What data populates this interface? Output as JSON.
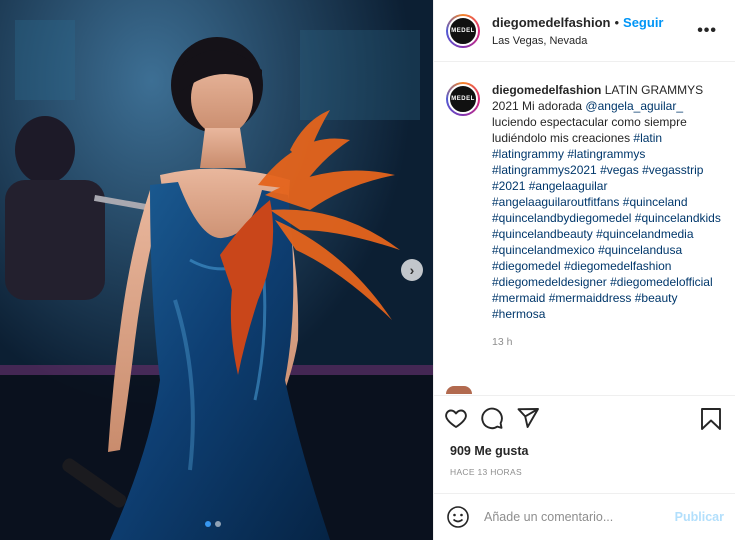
{
  "post": {
    "image_alt": "Woman in blue satin mermaid gown with orange feather shoulder detail on stage",
    "next_icon": "chevron-right-icon",
    "carousel": {
      "total": 2,
      "active": 0
    }
  },
  "header": {
    "username": "diegomedelfashion",
    "separator": "•",
    "follow_label": "Seguir",
    "location": "Las Vegas, Nevada",
    "more_icon": "more-options-icon",
    "more_label": "•••",
    "avatar_text": "MEDEL"
  },
  "caption": {
    "username": "diegomedelfashion",
    "title": "LATIN GRAMMYS 2021",
    "body_parts": [
      {
        "t": "Mi adorada ",
        "tag": false
      },
      {
        "t": "@angela_aguilar_",
        "tag": true
      },
      {
        "t": " luciendo espectacular como siempre ludiéndolo mis creaciones ",
        "tag": false
      },
      {
        "t": "#latin",
        "tag": true
      },
      {
        "t": " ",
        "tag": false
      },
      {
        "t": "#latingrammy",
        "tag": true
      },
      {
        "t": " ",
        "tag": false
      },
      {
        "t": "#latingrammys",
        "tag": true
      },
      {
        "t": " ",
        "tag": false
      },
      {
        "t": "#latingrammys2021",
        "tag": true
      },
      {
        "t": " ",
        "tag": false
      },
      {
        "t": "#vegas",
        "tag": true
      },
      {
        "t": " ",
        "tag": false
      },
      {
        "t": "#vegasstrip",
        "tag": true
      },
      {
        "t": " ",
        "tag": false
      },
      {
        "t": "#2021",
        "tag": true
      },
      {
        "t": " ",
        "tag": false
      },
      {
        "t": "#angelaaguilar",
        "tag": true
      },
      {
        "t": " ",
        "tag": false
      },
      {
        "t": "#angelaaguilaroutfitfans",
        "tag": true
      },
      {
        "t": " ",
        "tag": false
      },
      {
        "t": "#quinceland",
        "tag": true
      },
      {
        "t": " ",
        "tag": false
      },
      {
        "t": "#quincelandbydiegomedel",
        "tag": true
      },
      {
        "t": " ",
        "tag": false
      },
      {
        "t": "#quincelandkids",
        "tag": true
      },
      {
        "t": " ",
        "tag": false
      },
      {
        "t": "#quincelandbeauty",
        "tag": true
      },
      {
        "t": " ",
        "tag": false
      },
      {
        "t": "#quincelandmedia",
        "tag": true
      },
      {
        "t": " ",
        "tag": false
      },
      {
        "t": "#quincelandmexico",
        "tag": true
      },
      {
        "t": " ",
        "tag": false
      },
      {
        "t": "#quincelandusa",
        "tag": true
      },
      {
        "t": " ",
        "tag": false
      },
      {
        "t": "#diegomedel",
        "tag": true
      },
      {
        "t": " ",
        "tag": false
      },
      {
        "t": "#diegomedelfashion",
        "tag": true
      },
      {
        "t": " ",
        "tag": false
      },
      {
        "t": "#diegomedeldesigner",
        "tag": true
      },
      {
        "t": " ",
        "tag": false
      },
      {
        "t": "#diegomedelofficial",
        "tag": true
      },
      {
        "t": " ",
        "tag": false
      },
      {
        "t": "#mermaid",
        "tag": true
      },
      {
        "t": " ",
        "tag": false
      },
      {
        "t": "#mermaiddress",
        "tag": true
      },
      {
        "t": " ",
        "tag": false
      },
      {
        "t": "#beauty",
        "tag": true
      },
      {
        "t": " ",
        "tag": false
      },
      {
        "t": "#hermosa",
        "tag": true
      }
    ],
    "time": "13 h"
  },
  "actions": {
    "like_icon": "heart-icon",
    "comment_icon": "comment-icon",
    "share_icon": "share-icon",
    "save_icon": "bookmark-icon"
  },
  "likes": "909 Me gusta",
  "posted_ago": "HACE 13 HORAS",
  "comment": {
    "emoji_icon": "emoji-icon",
    "placeholder": "Añade un comentario...",
    "value": "",
    "publish_label": "Publicar"
  },
  "colors": {
    "link": "#00376b",
    "follow": "#0095f6",
    "publish_disabled": "#b2dffc",
    "carousel_active": "#3897f0"
  }
}
